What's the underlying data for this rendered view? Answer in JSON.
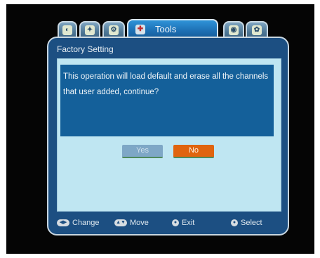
{
  "tabs": [
    {
      "icon": "dish-icon"
    },
    {
      "icon": "satellite-icon"
    },
    {
      "icon": "settings-icon"
    },
    {
      "icon": "toolbox-icon",
      "label": "Tools",
      "active": true
    },
    {
      "icon": "gear-icon"
    },
    {
      "icon": "games-icon"
    }
  ],
  "panel": {
    "title": "Factory Setting",
    "message_line1": "This operation will load default and erase all the channels",
    "message_line2": "that user added, continue?",
    "yes_label": "Yes",
    "no_label": "No",
    "selected": "No"
  },
  "help": {
    "change": "Change",
    "move": "Move",
    "exit": "Exit",
    "select": "Select"
  },
  "colors": {
    "panel": "#1c4f82",
    "content": "#bfe6f2",
    "message": "#14609a",
    "active_tab": "#1d6fb3",
    "selected_button": "#e0640f"
  }
}
